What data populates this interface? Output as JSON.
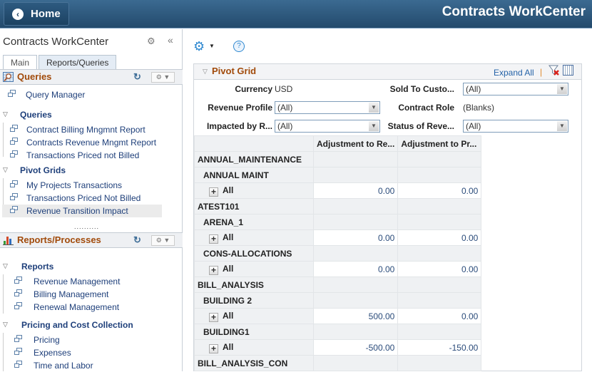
{
  "header": {
    "home_label": "Home",
    "title": "Contracts WorkCenter"
  },
  "left": {
    "title": "Contracts WorkCenter",
    "tabs": [
      {
        "label": "Main",
        "active": false
      },
      {
        "label": "Reports/Queries",
        "active": true
      }
    ],
    "queries_pagelet": {
      "title": "Queries",
      "top_item": "Query Manager",
      "folders": [
        {
          "label": "Queries",
          "items": [
            "Contract Billing Mngmnt Report",
            "Contracts Revenue Mngmt Report",
            "Transactions Priced not Billed"
          ]
        },
        {
          "label": "Pivot Grids",
          "items": [
            "My Projects Transactions",
            "Transactions Priced Not Billed",
            "Revenue Transition Impact"
          ]
        }
      ],
      "selected_item": "Revenue Transition Impact"
    },
    "splitter": "..........",
    "reports_pagelet": {
      "title": "Reports/Processes",
      "folders": [
        {
          "label": "Reports",
          "items": [
            "Revenue Management",
            "Billing Management",
            "Renewal Management"
          ]
        },
        {
          "label": "Pricing and Cost Collection",
          "items": [
            "Pricing",
            "Expenses",
            "Time and Labor"
          ]
        }
      ]
    }
  },
  "content": {
    "help_label": "?",
    "pivot_grid": {
      "title": "Pivot Grid",
      "expand_all": "Expand All",
      "separator": "|",
      "filters": {
        "currency": {
          "label": "Currency",
          "value": "USD"
        },
        "sold_to": {
          "label": "Sold To Custo...",
          "value": "(All)"
        },
        "revenue_profile": {
          "label": "Revenue Profile",
          "value": "(All)"
        },
        "contract_role": {
          "label": "Contract Role",
          "value": "(Blanks)"
        },
        "impacted_by": {
          "label": "Impacted by R...",
          "value": "(All)"
        },
        "status_of_rev": {
          "label": "Status of Reve...",
          "value": "(All)"
        }
      },
      "columns": [
        "",
        "Adjustment to Re...",
        "Adjustment to Pr..."
      ],
      "rows": [
        {
          "label": "ANNUAL_MAINTENANCE",
          "level": 1
        },
        {
          "label": "ANNUAL MAINT",
          "level": 2
        },
        {
          "label": "All",
          "level": 3,
          "values": [
            "0.00",
            "0.00"
          ]
        },
        {
          "label": "ATEST101",
          "level": 1
        },
        {
          "label": "ARENA_1",
          "level": 2
        },
        {
          "label": "All",
          "level": 3,
          "values": [
            "0.00",
            "0.00"
          ]
        },
        {
          "label": "CONS-ALLOCATIONS",
          "level": 2
        },
        {
          "label": "All",
          "level": 3,
          "values": [
            "0.00",
            "0.00"
          ]
        },
        {
          "label": "BILL_ANALYSIS",
          "level": 1
        },
        {
          "label": "BUILDING 2",
          "level": 2
        },
        {
          "label": "All",
          "level": 3,
          "values": [
            "500.00",
            "0.00"
          ]
        },
        {
          "label": "BUILDING1",
          "level": 2
        },
        {
          "label": "All",
          "level": 3,
          "values": [
            "-500.00",
            "-150.00"
          ]
        },
        {
          "label": "BILL_ANALYSIS_CON",
          "level": 1
        }
      ]
    }
  }
}
